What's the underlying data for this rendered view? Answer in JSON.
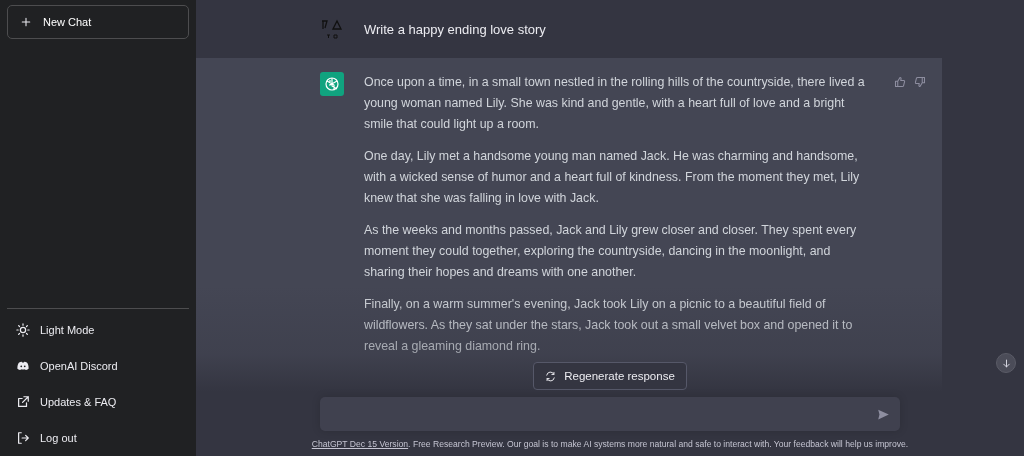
{
  "sidebar": {
    "new_chat": "New Chat",
    "menu": [
      {
        "label": "Light Mode",
        "kind": "sun"
      },
      {
        "label": "OpenAI Discord",
        "kind": "discord"
      },
      {
        "label": "Updates & FAQ",
        "kind": "external"
      },
      {
        "label": "Log out",
        "kind": "logout"
      }
    ]
  },
  "conversation": {
    "prompt": "Write a happy ending love story",
    "reply": [
      "Once upon a time, in a small town nestled in the rolling hills of the countryside, there lived a young woman named Lily. She was kind and gentle, with a heart full of love and a bright smile that could light up a room.",
      "One day, Lily met a handsome young man named Jack. He was charming and handsome, with a wicked sense of humor and a heart full of kindness. From the moment they met, Lily knew that she was falling in love with Jack.",
      "As the weeks and months passed, Jack and Lily grew closer and closer. They spent every moment they could together, exploring the countryside, dancing in the moonlight, and sharing their hopes and dreams with one another.",
      "Finally, on a warm summer's evening, Jack took Lily on a picnic to a beautiful field of wildflowers. As they sat under the stars, Jack took out a small velvet box and opened it to reveal a gleaming diamond ring."
    ]
  },
  "regenerate": "Regenerate response",
  "footer": {
    "link": "ChatGPT Dec 15 Version",
    "text": ". Free Research Preview. Our goal is to make AI systems more natural and safe to interact with. Your feedback will help us improve."
  }
}
